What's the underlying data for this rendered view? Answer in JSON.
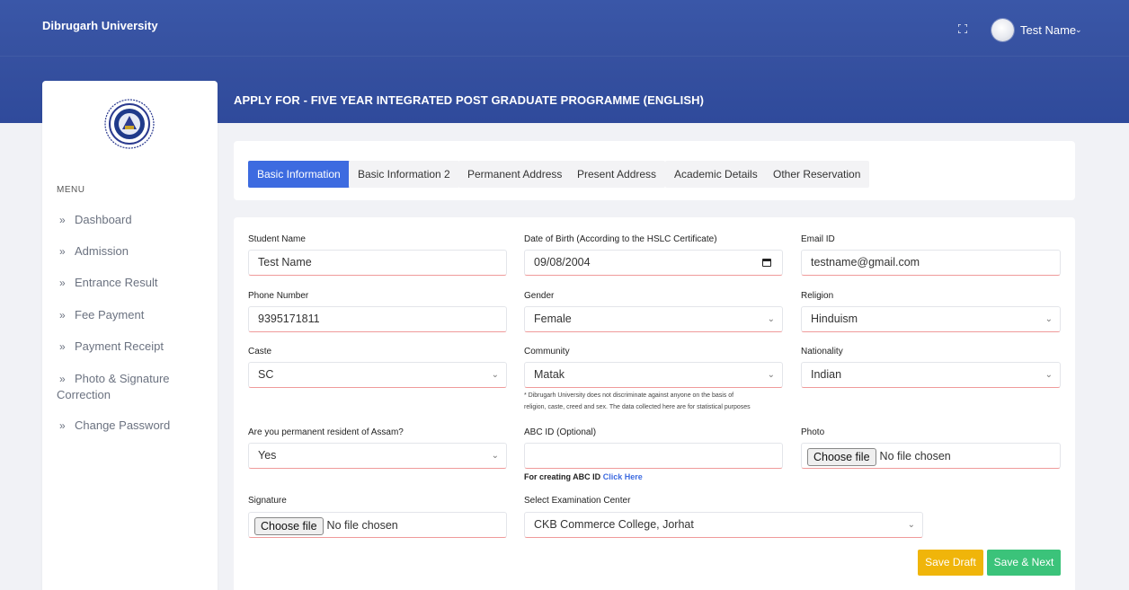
{
  "app": {
    "brand": "Dibrugarh University"
  },
  "header": {
    "user_name": "Test Name",
    "user_caret": "⌄"
  },
  "sidebar": {
    "menu_title": "MENU",
    "items": [
      {
        "label": "Dashboard"
      },
      {
        "label": "Admission"
      },
      {
        "label": "Entrance Result"
      },
      {
        "label": "Fee Payment"
      },
      {
        "label": "Payment Receipt"
      },
      {
        "label": "Photo & Signature",
        "label2": "Correction"
      },
      {
        "label": "Change Password"
      }
    ],
    "arrow": "»"
  },
  "page": {
    "title": "APPLY FOR - FIVE YEAR INTEGRATED POST GRADUATE PROGRAMME (ENGLISH)"
  },
  "tabs": [
    {
      "label": "Basic Information",
      "active": true
    },
    {
      "label": "Basic Information 2"
    },
    {
      "label": "Permanent Address"
    },
    {
      "label": "Present Address"
    },
    {
      "label": "Academic Details"
    },
    {
      "label": "Other Reservation"
    }
  ],
  "form": {
    "student_name": {
      "label": "Student Name",
      "value": "Test Name"
    },
    "dob": {
      "label": "Date of Birth (According to the HSLC Certificate)",
      "value": "09/08/2004"
    },
    "email": {
      "label": "Email ID",
      "value": "testname@gmail.com"
    },
    "phone": {
      "label": "Phone Number",
      "value": "9395171811"
    },
    "gender": {
      "label": "Gender",
      "value": "Female"
    },
    "religion": {
      "label": "Religion",
      "value": "Hinduism"
    },
    "caste": {
      "label": "Caste",
      "value": "SC"
    },
    "community": {
      "label": "Community",
      "value": "Matak"
    },
    "nationality": {
      "label": "Nationality",
      "value": "Indian"
    },
    "community_note_1": "* Dibrugarh University does not discriminate against anyone on the basis of",
    "community_note_2": "religion, caste, creed and sex. The data collected here are for statistical purposes",
    "resident": {
      "label": "Are you permanent resident of Assam?",
      "value": "Yes"
    },
    "abc": {
      "label": "ABC ID (Optional)",
      "value": "",
      "help_prefix": "For creating ABC ID",
      "help_link": "Click Here"
    },
    "photo": {
      "label": "Photo",
      "button": "Choose file",
      "status": "No file chosen"
    },
    "signature": {
      "label": "Signature",
      "button": "Choose file",
      "status": "No file chosen"
    },
    "exam_center": {
      "label": "Select Examination Center",
      "value": "CKB Commerce College, Jorhat"
    }
  },
  "buttons": {
    "save_draft": "Save Draft",
    "save_next": "Save & Next"
  },
  "colors": {
    "header_bg": "#3651a0",
    "accent": "#3d6be0",
    "draft": "#f0b50a",
    "next": "#3bc37a",
    "invalid_border": "#ef9a9a"
  },
  "icons": {
    "fullscreen": "fullscreen-icon",
    "chevron": "chevron-down-icon",
    "calendar": "calendar-icon",
    "logo": "university-seal-logo"
  }
}
